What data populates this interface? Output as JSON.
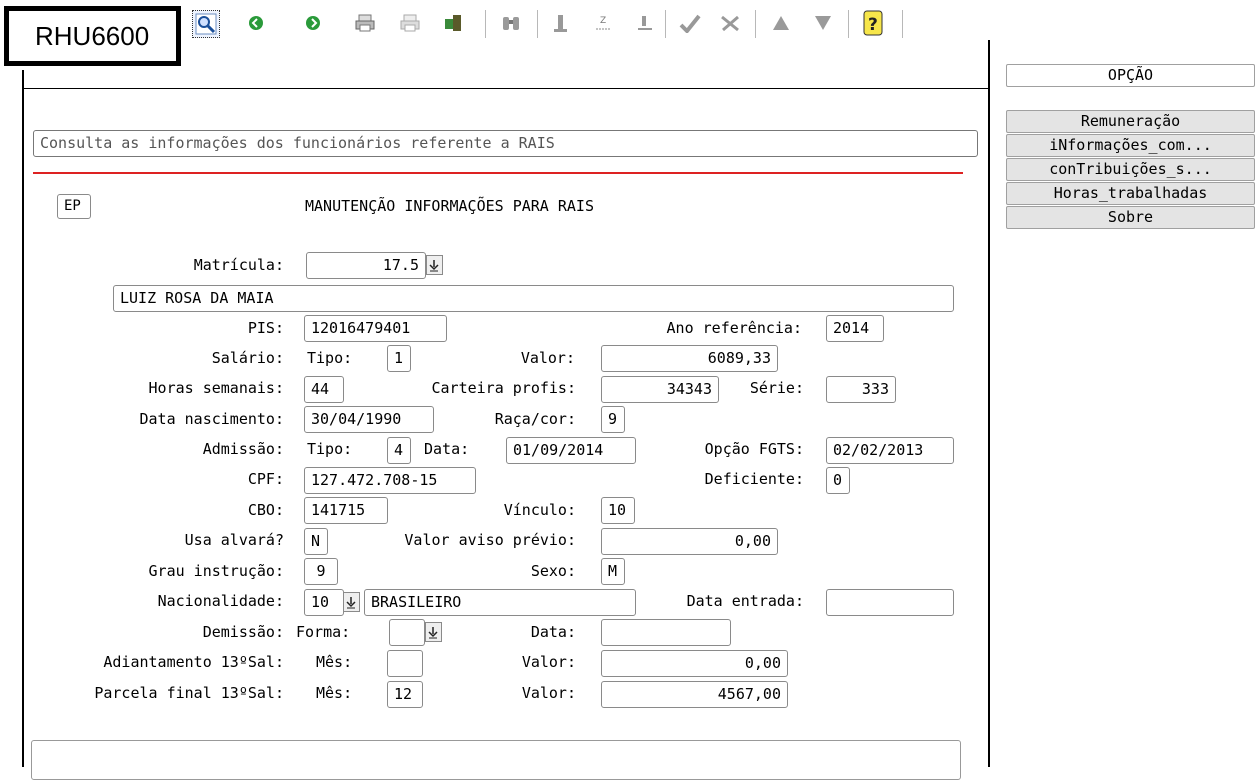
{
  "program_code": "RHU6600",
  "description": "Consulta as informações dos funcionários referente a RAIS",
  "ep_label": "EP",
  "form_title": "MANUTENÇÃO INFORMAÇÕES PARA RAIS",
  "toolbar": {
    "icons": [
      "search-icon",
      "prev-icon",
      "next-icon",
      "print-icon",
      "print-disabled-icon",
      "exit-icon",
      "binoculars-icon",
      "number-one-icon",
      "zoom-icon",
      "underline-icon",
      "check-icon",
      "cancel-icon",
      "up-triangle-icon",
      "down-triangle-icon",
      "help-icon"
    ]
  },
  "side": {
    "header": "OPÇÃO",
    "items": [
      "Remuneração",
      "iNformações_com...",
      "conTribuições_s...",
      "Horas_trabalhadas",
      "Sobre"
    ]
  },
  "form": {
    "matricula_label": "Matrícula:",
    "matricula": "17.5",
    "nome": "LUIZ ROSA DA MAIA",
    "pis_label": "PIS:",
    "pis": "12016479401",
    "ano_ref_label": "Ano referência:",
    "ano_ref": "2014",
    "salario_label": "Salário:",
    "tipo_label": "Tipo:",
    "salario_tipo": "1",
    "valor_label": "Valor:",
    "salario_valor": "6089,33",
    "horas_label": "Horas semanais:",
    "horas": "44",
    "carteira_label": "Carteira profis:",
    "carteira": "34343",
    "serie_label": "Série:",
    "serie": "333",
    "nasc_label": "Data nascimento:",
    "nasc": "30/04/1990",
    "raca_label": "Raça/cor:",
    "raca": "9",
    "admissao_label": "Admissão:",
    "adm_tipo": "4",
    "data_label": "Data:",
    "adm_data": "01/09/2014",
    "fgts_label": "Opção FGTS:",
    "fgts": "02/02/2013",
    "cpf_label": "CPF:",
    "cpf": "127.472.708-15",
    "deficiente_label": "Deficiente:",
    "deficiente": "0",
    "cbo_label": "CBO:",
    "cbo": "141715",
    "vinculo_label": "Vínculo:",
    "vinculo": "10",
    "alvara_label": "Usa alvará?",
    "alvara": "N",
    "aviso_label": "Valor aviso prévio:",
    "aviso": "0,00",
    "grau_label": "Grau instrução:",
    "grau": "9",
    "sexo_label": "Sexo:",
    "sexo": "M",
    "nac_label": "Nacionalidade:",
    "nac_cod": "10",
    "nac_desc": "BRASILEIRO",
    "entrada_label": "Data entrada:",
    "entrada": "",
    "demissao_label": "Demissão:",
    "forma_label": "Forma:",
    "dem_forma": "",
    "dem_data": "",
    "adiant_label": "Adiantamento 13ºSal:",
    "mes_label": "Mês:",
    "adiant_mes": "",
    "adiant_valor": "0,00",
    "parcela_label": "Parcela final 13ºSal:",
    "parcela_mes": "12",
    "parcela_valor": "4567,00"
  }
}
